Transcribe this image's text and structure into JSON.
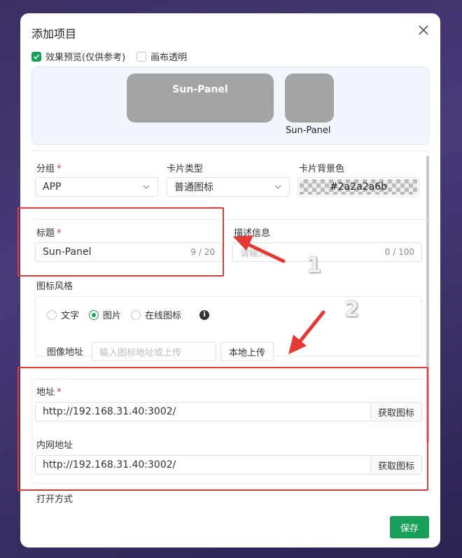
{
  "modal": {
    "title": "添加项目",
    "preview_checkbox": "效果预览(仅供参考)",
    "transparent_checkbox": "画布透明"
  },
  "preview": {
    "card_title": "Sun-Panel",
    "small_label": "Sun-Panel",
    "card_color": "#a3a4a5"
  },
  "form": {
    "group_label": "分组",
    "group_value": "APP",
    "card_type_label": "卡片类型",
    "card_type_value": "普通图标",
    "bg_color_label": "卡片背景色",
    "bg_color_value": "#2a2a2a6b",
    "title_label": "标题",
    "title_value": "Sun-Panel",
    "title_count": "9 / 20",
    "desc_label": "描述信息",
    "desc_placeholder": "请输入",
    "desc_count": "0 / 100",
    "icon_style_label": "图标风格",
    "icon_style_options": [
      "文字",
      "图片",
      "在线图标"
    ],
    "icon_style_selected": "图片",
    "image_url_label": "图像地址",
    "image_url_placeholder": "输入图标地址或上传",
    "upload_button": "本地上传",
    "url_label": "地址",
    "url_value": "http://192.168.31.40:3002/",
    "fetch_icon_button": "获取图标",
    "lan_url_label": "内网地址",
    "lan_url_value": "http://192.168.31.40:3002/",
    "fetch_icon_button_2": "获取图标",
    "open_mode_label": "打开方式",
    "required_mark": "*",
    "info_glyph": "i"
  },
  "annotations": {
    "num1": "1",
    "num2": "2",
    "color": "#e53935"
  },
  "footer": {
    "save_button": "保存",
    "accent": "#18a058"
  }
}
